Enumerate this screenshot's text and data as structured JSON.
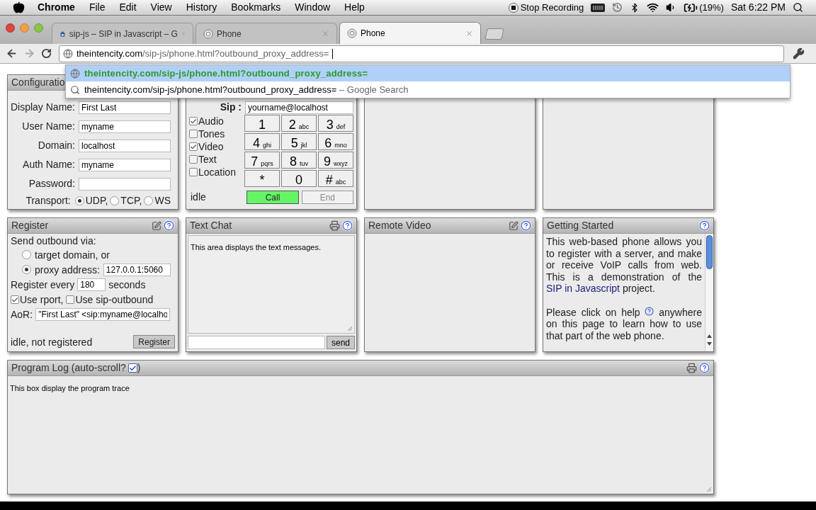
{
  "menubar": {
    "app": "Chrome",
    "menus": [
      "File",
      "Edit",
      "View",
      "History",
      "Bookmarks",
      "Window",
      "Help"
    ],
    "recording": "Stop Recording",
    "battery": "(19%)",
    "clock": "Sat 6:22 PM"
  },
  "tabs": [
    {
      "kind": "project",
      "title": "sip-js – SIP in Javascript – G",
      "selected": false
    },
    {
      "kind": "phone",
      "title": "Phone",
      "selected": false
    },
    {
      "kind": "phone",
      "title": "Phone",
      "selected": true
    }
  ],
  "address_bar": {
    "host": "theintencity.com",
    "path": "/sip-js/phone.html?outbound_proxy_address="
  },
  "suggestions": [
    {
      "kind": "url",
      "text": "theintencity.com/sip-js/phone.html?outbound_proxy_address=",
      "selected": true
    },
    {
      "kind": "search",
      "text": "theintencity.com/sip-js/phone.html?outbound_proxy_address=",
      "suffix": "– Google Search",
      "selected": false
    }
  ],
  "configuration": {
    "title": "Configuratio",
    "fields": [
      {
        "label": "Display Name:",
        "value": "First Last"
      },
      {
        "label": "User Name:",
        "value": "myname"
      },
      {
        "label": "Domain:",
        "value": "localhost"
      },
      {
        "label": "Auth Name:",
        "value": "myname"
      },
      {
        "label": "Password:"
      }
    ],
    "transport": {
      "label": "Transport:",
      "options": [
        {
          "label": "UDP,",
          "selected": true
        },
        {
          "label": "TCP,",
          "selected": false
        },
        {
          "label": "WS",
          "selected": false
        }
      ]
    }
  },
  "phone": {
    "sip_label": "Sip :",
    "sip_value": "yourname@localhost",
    "media": [
      {
        "label": "Audio",
        "checked": true
      },
      {
        "label": "Tones",
        "checked": false
      },
      {
        "label": "Video",
        "checked": true
      },
      {
        "label": "Text",
        "checked": false
      },
      {
        "label": "Location",
        "checked": false
      }
    ],
    "keys": [
      {
        "digit": "1"
      },
      {
        "digit": "2",
        "letters": "abc"
      },
      {
        "digit": "3",
        "letters": "def"
      },
      {
        "digit": "4",
        "letters": "ghi"
      },
      {
        "digit": "5",
        "letters": "jkl"
      },
      {
        "digit": "6",
        "letters": "mno"
      },
      {
        "digit": "7",
        "letters": "pqrs"
      },
      {
        "digit": "8",
        "letters": "tuv"
      },
      {
        "digit": "9",
        "letters": "wxyz"
      },
      {
        "digit": "*"
      },
      {
        "digit": "0"
      },
      {
        "digit": "#",
        "letters": "abc"
      }
    ],
    "status": "idle",
    "buttons": [
      {
        "label": "Call",
        "disabled": false
      },
      {
        "label": "End",
        "disabled": true
      }
    ]
  },
  "register": {
    "title": "Register",
    "outbound_label": "Send outbound via:",
    "routes": [
      {
        "label": "target domain, or",
        "selected": false
      },
      {
        "label": "proxy address:",
        "selected": true,
        "value": "127.0.0.1:5060"
      }
    ],
    "interval": {
      "before": "Register every",
      "value": "180",
      "after": "seconds"
    },
    "options": [
      {
        "label": "Use rport,",
        "checked": true
      },
      {
        "label": "Use sip-outbound",
        "checked": false
      }
    ],
    "aor": {
      "label": "AoR:",
      "value": "\"First Last\" <sip:myname@localho"
    },
    "status": "idle, not registered",
    "button": "Register"
  },
  "text_chat": {
    "title": "Text Chat",
    "messages": "This area displays the text messages.",
    "send": "send"
  },
  "remote_video": {
    "title": "Remote Video"
  },
  "getting_started": {
    "title": "Getting Started",
    "intro": {
      "before": "This web-based phone allows you to register with a server, and make or receive VoIP calls from web. This is a demonstration of the",
      "link": "SIP in Javascript",
      "after": "project."
    },
    "help": {
      "before": "Please click on help",
      "after": "anywhere on this page to learn how to use that part of the web phone."
    }
  },
  "program_log": {
    "title": "Program Log (auto-scroll?",
    "autoscroll": true,
    "close": ")",
    "trace": "This box display the program trace"
  }
}
